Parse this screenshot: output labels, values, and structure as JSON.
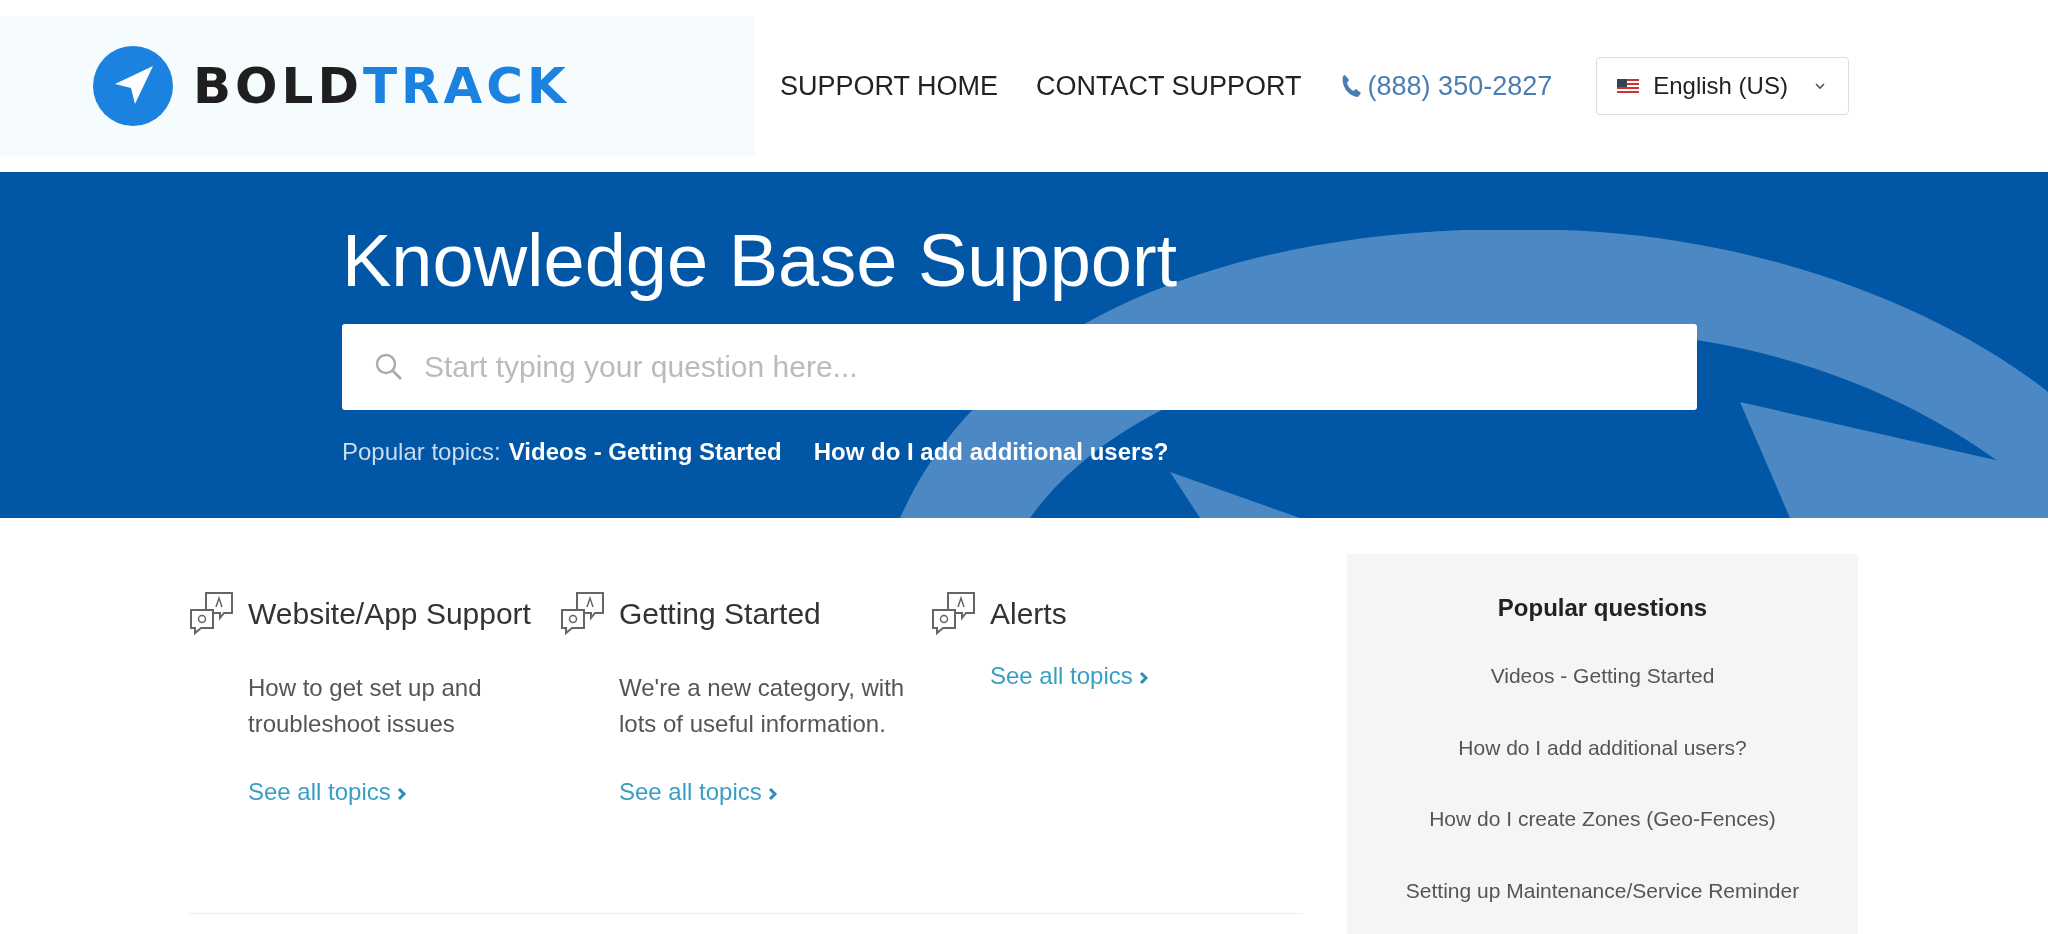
{
  "header": {
    "logo": [
      {
        "text": "BOLD",
        "kind": "dark"
      },
      {
        "text": "TRACK",
        "kind": "accent"
      }
    ],
    "nav": [
      {
        "label": "SUPPORT HOME"
      },
      {
        "label": "CONTACT SUPPORT"
      }
    ],
    "phone": "(888) 350-2827",
    "language": "English (US)"
  },
  "hero": {
    "title": "Knowledge Base Support",
    "search": {
      "placeholder": "Start typing your question here..."
    },
    "popular_label": "Popular topics:",
    "popular_topics": [
      "Videos - Getting Started",
      "How do I add additional users?"
    ]
  },
  "categories": [
    {
      "title": "Website/App Support",
      "description": "How to get set up and troubleshoot issues",
      "link": "See all topics"
    },
    {
      "title": "Getting Started",
      "description": "We're a new category, with lots of useful information.",
      "link": "See all topics"
    },
    {
      "title": "Alerts",
      "link": "See all topics"
    }
  ],
  "sidebar": {
    "title": "Popular questions",
    "items": [
      "Videos - Getting Started",
      "How do I add additional users?",
      "How do I create Zones (Geo-Fences)",
      "Setting up Maintenance/Service Reminder"
    ]
  }
}
